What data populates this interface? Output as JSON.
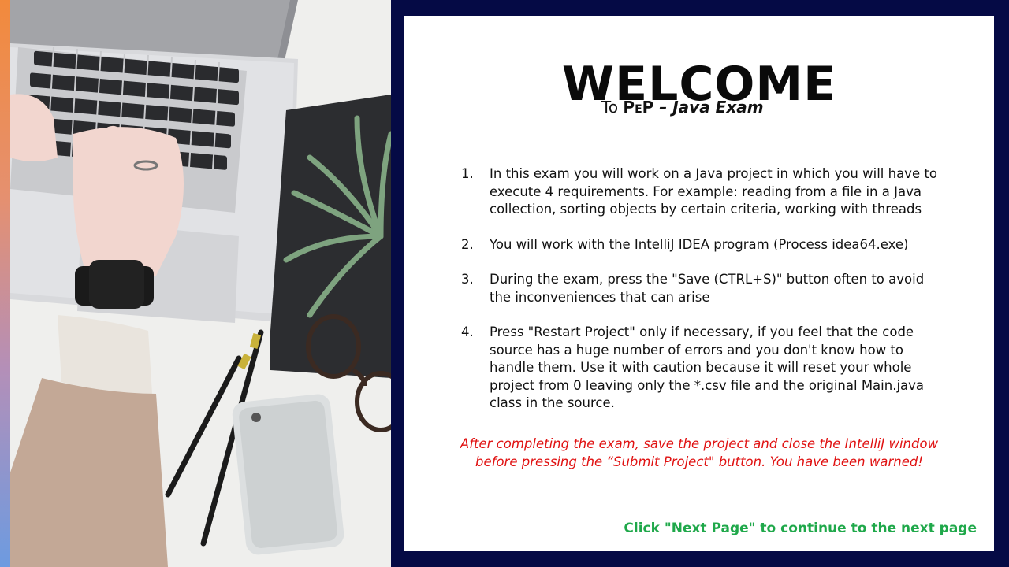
{
  "welcome": {
    "title": "WELCOME",
    "subtitle_to": "To ",
    "subtitle_pep": "PeP",
    "subtitle_rest": " – Java Exam"
  },
  "instructions": [
    {
      "num": "1.",
      "text": "In this exam you will work on a Java project in which you will have to execute 4 requirements. For example: reading from a file in a Java collection, sorting objects by certain criteria, working with threads"
    },
    {
      "num": "2.",
      "text": "You will work with the IntelliJ IDEA program (Process idea64.exe)"
    },
    {
      "num": "3.",
      "text": "During the exam, press the \"Save (CTRL+S)\" button often to avoid the inconveniences that can arise"
    },
    {
      "num": "4.",
      "text": "Press \"Restart Project\" only if necessary, if you feel that the code source has a huge number of errors and you don't know how to handle them. Use it with caution because it will reset your whole project from 0 leaving only the *.csv file and the original Main.java class in the source."
    }
  ],
  "warning": {
    "line1": "After completing the exam, save the project and close the IntelliJ window",
    "line2": "before pressing the “Submit Project\" button. You have been warned!"
  },
  "footer": {
    "next_hint": "Click \"Next Page\" to continue to the next page"
  },
  "colors": {
    "background": "#050a45",
    "warning": "#e01212",
    "next_hint": "#1fa84a"
  }
}
